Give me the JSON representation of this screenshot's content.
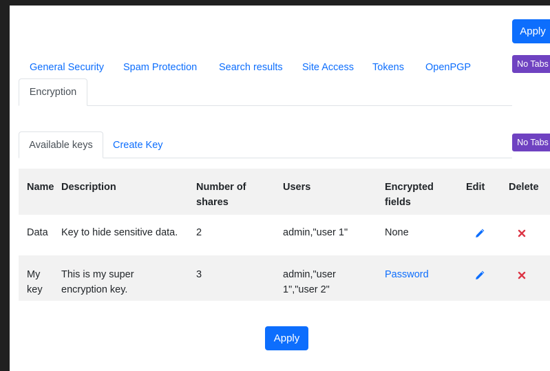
{
  "toolbar": {
    "apply_label": "Apply",
    "no_tabs_label": "No Tabs"
  },
  "main_tabs": [
    {
      "label": "General Security"
    },
    {
      "label": "Spam Protection"
    },
    {
      "label": "Search results"
    },
    {
      "label": "Site Access"
    },
    {
      "label": "Tokens"
    },
    {
      "label": "OpenPGP"
    },
    {
      "label": "Encryption",
      "active": true
    }
  ],
  "sub_tabs": [
    {
      "label": "Available keys",
      "active": true
    },
    {
      "label": "Create Key"
    }
  ],
  "table": {
    "headers": {
      "name": "Name",
      "description": "Description",
      "shares_line1": "Number of",
      "shares_line2": "shares",
      "users": "Users",
      "fields_line1": "Encrypted",
      "fields_line2": "fields",
      "edit": "Edit",
      "delete": "Delete"
    },
    "rows": [
      {
        "name": "Data",
        "description": "Key to hide sensitive data.",
        "shares": "2",
        "users": "admin,\"user 1\"",
        "fields": "None",
        "fields_is_link": false
      },
      {
        "name_line1": "My",
        "name_line2": "key",
        "description_line1": "This is my super",
        "description_line2": "encryption key.",
        "shares": "3",
        "users_line1": "admin,\"user",
        "users_line2": "1\",\"user 2\"",
        "fields": "Password",
        "fields_is_link": true
      }
    ]
  },
  "footer": {
    "apply_label": "Apply"
  },
  "colors": {
    "primary": "#0d6efd",
    "purple": "#6f42c1",
    "delete_red": "#dc3545",
    "row_stripe": "#f2f2f2"
  },
  "icons": {
    "edit": "pencil-icon",
    "delete": "close-icon"
  }
}
